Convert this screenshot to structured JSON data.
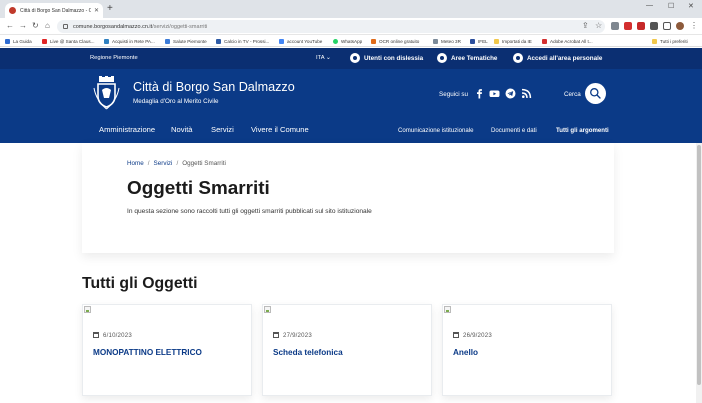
{
  "browser": {
    "tab_title": "Città di Borgo San Dalmazzo - O...",
    "url_host": "comune.borgosandalmazzo.cn.it",
    "url_path": "/servizi/oggetti-smarriti",
    "bookmarks": [
      {
        "label": "La Guida",
        "color": "#2e6bd1"
      },
      {
        "label": "Live @ Santa Claus...",
        "color": "#e02424"
      },
      {
        "label": "Acquisti in Rete PA...",
        "color": "#2f80c0"
      },
      {
        "label": "Salute Piemonte",
        "color": "#3b7bd8"
      },
      {
        "label": "Calcio in TV - Prossi...",
        "color": "#2d5aa5"
      },
      {
        "label": "account YouTube",
        "color": "#4285f4"
      },
      {
        "label": "WhatsApp",
        "color": "#25d366"
      },
      {
        "label": "OCR online gratuito",
        "color": "#e06b1a"
      },
      {
        "label": "Meteo 3R",
        "color": "#7b8a99"
      },
      {
        "label": "IFEL",
        "color": "#2b4e9c"
      },
      {
        "label": "Importati da IE",
        "color": "#f2c84b"
      },
      {
        "label": "Adobe Acrobat All t...",
        "color": "#d32f2f"
      }
    ],
    "bookmarks_more": "Tutti i preferiti"
  },
  "topbar": {
    "region": "Regione Piemonte",
    "lang": "ITA",
    "links": [
      "Utenti con dislessia",
      "Aree Tematiche",
      "Accedi all'area personale"
    ]
  },
  "header": {
    "title": "Città di Borgo San Dalmazzo",
    "subtitle": "Medaglia d'Oro al Merito Civile",
    "social_label": "Seguici su",
    "social_icons": [
      "facebook-icon",
      "youtube-icon",
      "telegram-icon",
      "rss-icon"
    ],
    "search_label": "Cerca"
  },
  "menu": {
    "main": [
      "Amministrazione",
      "Novità",
      "Servizi",
      "Vivere il Comune"
    ],
    "secondary": [
      "Comunicazione istituzionale",
      "Documenti e dati",
      "Tutti gli argomenti"
    ]
  },
  "breadcrumb": {
    "home": "Home",
    "section": "Servizi",
    "current": "Oggetti Smarriti",
    "separator": "/"
  },
  "page": {
    "title": "Oggetti Smarriti",
    "description": "In questa sezione sono raccolti tutti gli oggetti smarriti pubblicati sul sito istituzionale"
  },
  "section": {
    "title": "Tutti gli Oggetti"
  },
  "cards": [
    {
      "date": "6/10/2023",
      "title": "MONOPATTINO ELETTRICO"
    },
    {
      "date": "27/9/2023",
      "title": "Scheda telefonica"
    },
    {
      "date": "26/9/2023",
      "title": "Anello"
    }
  ],
  "colors": {
    "topbar": "#0b2f72",
    "header": "#0b3a87",
    "link": "#0b3a87"
  }
}
